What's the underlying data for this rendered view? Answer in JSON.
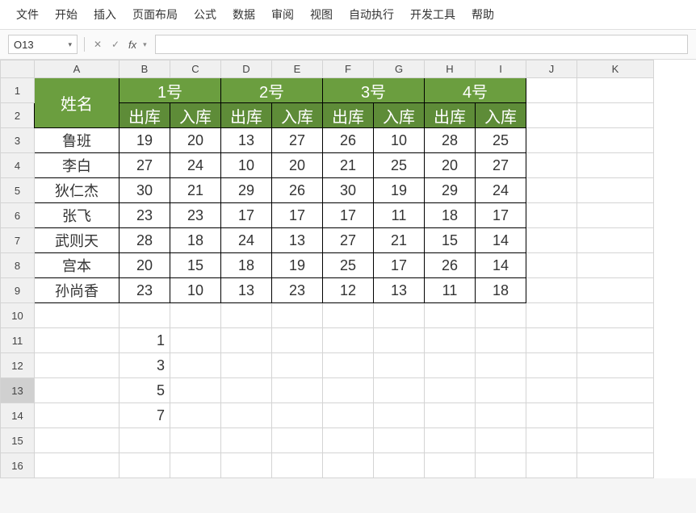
{
  "menu": [
    "文件",
    "开始",
    "插入",
    "页面布局",
    "公式",
    "数据",
    "审阅",
    "视图",
    "自动执行",
    "开发工具",
    "帮助"
  ],
  "nameBox": "O13",
  "formula": "",
  "cols": [
    "A",
    "B",
    "C",
    "D",
    "E",
    "F",
    "G",
    "H",
    "I",
    "J",
    "K"
  ],
  "header": {
    "name": "姓名",
    "days": [
      "1号",
      "2号",
      "3号",
      "4号"
    ],
    "sub": [
      "出库",
      "入库"
    ]
  },
  "rows": [
    {
      "name": "鲁班",
      "v": [
        19,
        20,
        13,
        27,
        26,
        10,
        28,
        25
      ]
    },
    {
      "name": "李白",
      "v": [
        27,
        24,
        10,
        20,
        21,
        25,
        20,
        27
      ]
    },
    {
      "name": "狄仁杰",
      "v": [
        30,
        21,
        29,
        26,
        30,
        19,
        29,
        24
      ]
    },
    {
      "name": "张飞",
      "v": [
        23,
        23,
        17,
        17,
        17,
        11,
        18,
        17
      ]
    },
    {
      "name": "武则天",
      "v": [
        28,
        18,
        24,
        13,
        27,
        21,
        15,
        14
      ]
    },
    {
      "name": "宫本",
      "v": [
        20,
        15,
        18,
        19,
        25,
        17,
        26,
        14
      ]
    },
    {
      "name": "孙尚香",
      "v": [
        23,
        10,
        13,
        23,
        12,
        13,
        11,
        18
      ]
    }
  ],
  "extra": {
    "b11": "1",
    "b12": "3",
    "b13": "5",
    "b14": "7"
  },
  "selectedRow": 13
}
